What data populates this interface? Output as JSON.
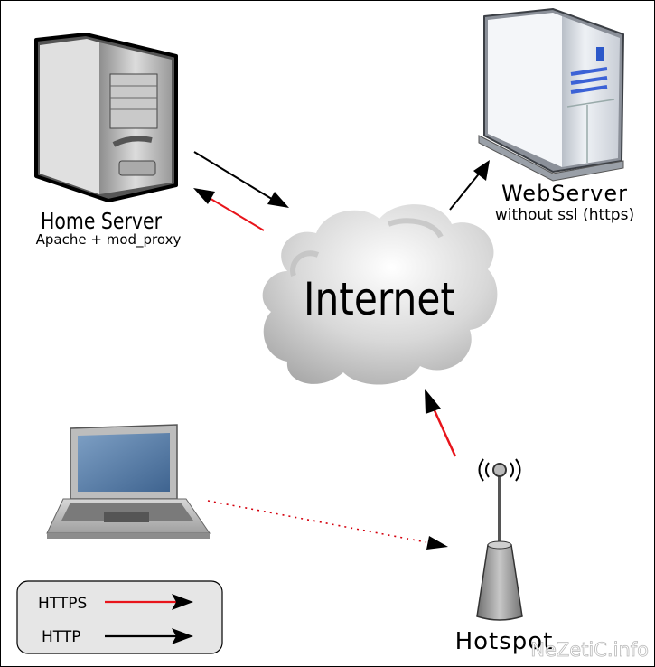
{
  "nodes": {
    "home_server": {
      "title": "Home Server",
      "subtitle": "Apache + mod_proxy"
    },
    "webserver": {
      "title": "WebServer",
      "subtitle": "without ssl (https)"
    },
    "internet": {
      "title": "Internet"
    },
    "hotspot": {
      "title": "Hotspot"
    }
  },
  "legend": {
    "items": [
      {
        "label": "HTTPS",
        "color": "#e8141b"
      },
      {
        "label": "HTTP",
        "color": "#000000"
      }
    ]
  },
  "watermark": "NeZetiC.info",
  "colors": {
    "https": "#e8141b",
    "http": "#000000",
    "laptop_link": "#d4000d"
  },
  "icons": [
    "tower-server-icon",
    "server-cabinet-icon",
    "cloud-icon",
    "laptop-icon",
    "wifi-antenna-icon"
  ]
}
